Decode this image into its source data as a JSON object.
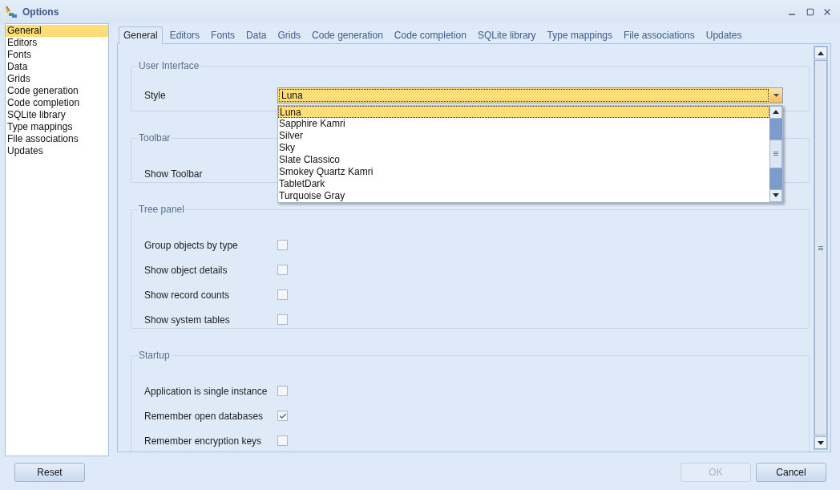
{
  "window": {
    "title": "Options"
  },
  "sidebar": {
    "items": [
      {
        "label": "General",
        "selected": true
      },
      {
        "label": "Editors",
        "selected": false
      },
      {
        "label": "Fonts",
        "selected": false
      },
      {
        "label": "Data",
        "selected": false
      },
      {
        "label": "Grids",
        "selected": false
      },
      {
        "label": "Code generation",
        "selected": false
      },
      {
        "label": "Code completion",
        "selected": false
      },
      {
        "label": "SQLite library",
        "selected": false
      },
      {
        "label": "Type mappings",
        "selected": false
      },
      {
        "label": "File associations",
        "selected": false
      },
      {
        "label": "Updates",
        "selected": false
      }
    ]
  },
  "tabs": [
    {
      "label": "General",
      "selected": true
    },
    {
      "label": "Editors",
      "selected": false
    },
    {
      "label": "Fonts",
      "selected": false
    },
    {
      "label": "Data",
      "selected": false
    },
    {
      "label": "Grids",
      "selected": false
    },
    {
      "label": "Code generation",
      "selected": false
    },
    {
      "label": "Code completion",
      "selected": false
    },
    {
      "label": "SQLite library",
      "selected": false
    },
    {
      "label": "Type mappings",
      "selected": false
    },
    {
      "label": "File associations",
      "selected": false
    },
    {
      "label": "Updates",
      "selected": false
    }
  ],
  "groups": [
    {
      "title": "User Interface",
      "rows": [
        {
          "kind": "dropdown",
          "label": "Style",
          "value": "Luna",
          "expanded": true,
          "options": [
            {
              "label": "Luna",
              "selected": true
            },
            {
              "label": "Sapphire Kamri",
              "selected": false
            },
            {
              "label": "Silver",
              "selected": false
            },
            {
              "label": "Sky",
              "selected": false
            },
            {
              "label": "Slate Classico",
              "selected": false
            },
            {
              "label": "Smokey Quartz Kamri",
              "selected": false
            },
            {
              "label": "TabletDark",
              "selected": false
            },
            {
              "label": "Turquoise Gray",
              "selected": false
            }
          ]
        }
      ]
    },
    {
      "title": "Toolbar",
      "rows": [
        {
          "kind": "checkbox",
          "label": "Show Toolbar"
        }
      ]
    },
    {
      "title": "Tree panel",
      "rows": [
        {
          "kind": "checkbox",
          "label": "Group objects by type",
          "checked": false
        },
        {
          "kind": "checkbox",
          "label": "Show object details",
          "checked": false
        },
        {
          "kind": "checkbox",
          "label": "Show record counts",
          "checked": false
        },
        {
          "kind": "checkbox",
          "label": "Show system tables",
          "checked": false
        }
      ]
    },
    {
      "title": "Startup",
      "rows": [
        {
          "kind": "checkbox",
          "label": "Application is single instance",
          "checked": false
        },
        {
          "kind": "checkbox",
          "label": "Remember open databases",
          "checked": true
        },
        {
          "kind": "checkbox",
          "label": "Remember encryption keys",
          "checked": false
        }
      ]
    }
  ],
  "buttons": [
    {
      "label": "Reset",
      "disabled": false
    },
    {
      "label": "OK",
      "disabled": true
    },
    {
      "label": "Cancel",
      "disabled": false
    }
  ]
}
